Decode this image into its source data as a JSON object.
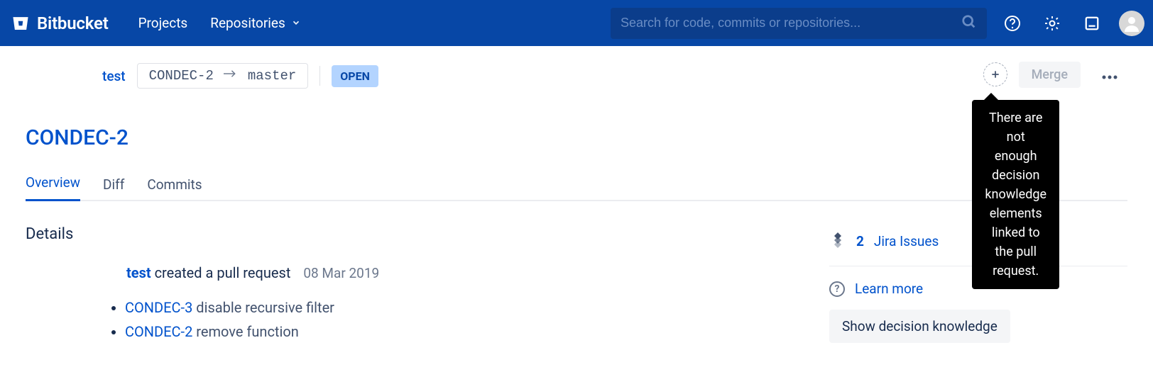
{
  "header": {
    "brand": "Bitbucket",
    "nav_projects": "Projects",
    "nav_repositories": "Repositories",
    "search_placeholder": "Search for code, commits or repositories..."
  },
  "breadcrumb": {
    "project": "test",
    "source_branch": "CONDEC-2",
    "target_branch": "master",
    "status": "OPEN",
    "merge_label": "Merge",
    "tooltip": "There are not enough decision knowledge elements linked to the pull request."
  },
  "pr": {
    "title": "CONDEC-2",
    "tabs": {
      "overview": "Overview",
      "diff": "Diff",
      "commits": "Commits"
    },
    "details_heading": "Details",
    "author": "test",
    "created_text": "created a pull request",
    "date": "08 Mar 2019",
    "commits": [
      {
        "key": "CONDEC-3",
        "msg": "disable recursive filter"
      },
      {
        "key": "CONDEC-2",
        "msg": "remove function"
      }
    ]
  },
  "side": {
    "jira_count": "2",
    "jira_label": "Jira Issues",
    "learn_more": "Learn more",
    "show_dk": "Show decision knowledge"
  }
}
